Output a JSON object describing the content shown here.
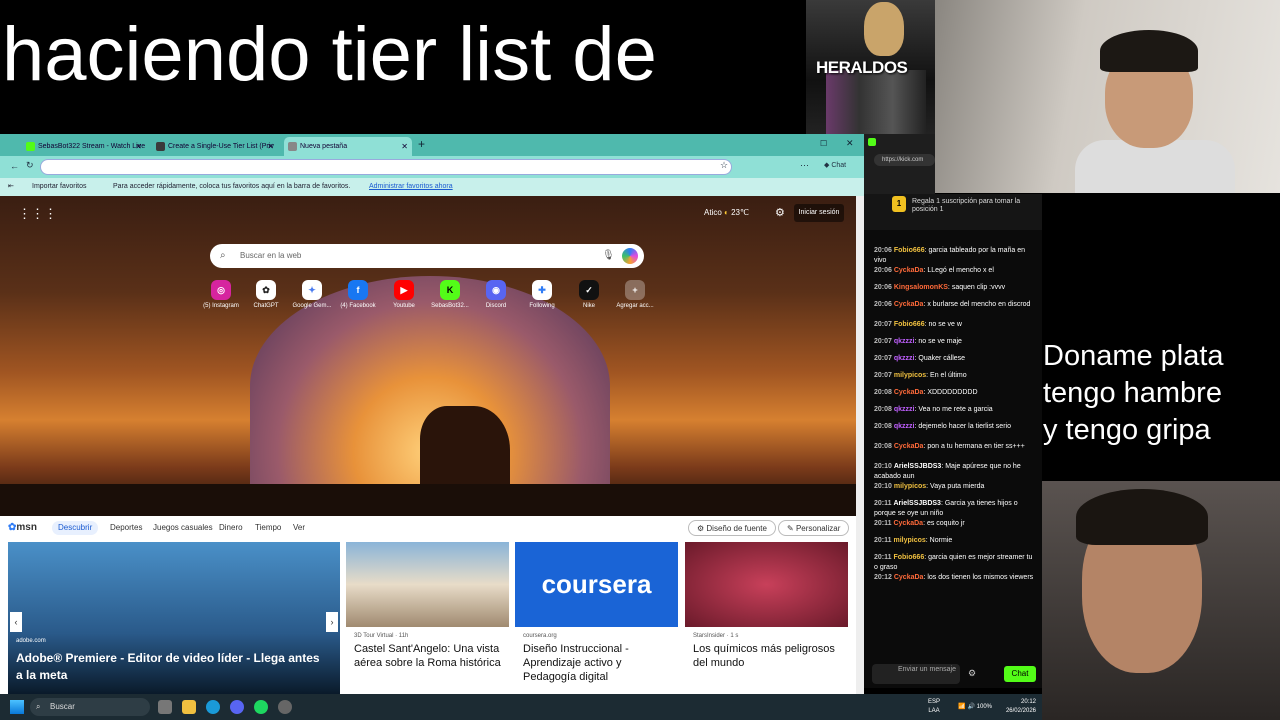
{
  "overlay": {
    "title": "haciendo tier list de",
    "heraldos_label": "HERALDOS",
    "donate_text": [
      "Doname plata",
      "tengo hambre",
      "y tengo gripa"
    ]
  },
  "browser": {
    "tabs": [
      {
        "label": "SebasBot322 Stream - Watch Live",
        "color": "#53fc18"
      },
      {
        "label": "Create a Single-Use Tier List (Priv",
        "color": "#3a3a3a"
      },
      {
        "label": "Nueva pestaña",
        "color": "#888"
      }
    ],
    "chat_button": "Chat",
    "favorites": {
      "import": "Importar favoritos",
      "hint": "Para acceder rápidamente, coloca tus favoritos aquí en la barra de favoritos.",
      "manage": "Administrar favoritos ahora"
    },
    "ntp": {
      "weather_city": "Atico",
      "weather_temp": "23℃",
      "signin": "Iniciar sesión",
      "search_placeholder": "Buscar en la web",
      "shortcuts": [
        "(5) Instagram",
        "ChatGPT",
        "Google Gem...",
        "(4) Facebook",
        "Youtube",
        "SebasBot32...",
        "Discord",
        "Following",
        "Nike",
        "Agregar acc..."
      ]
    },
    "msn": {
      "logo": "msn",
      "tabs": [
        "Descubrir",
        "Deportes",
        "Juegos casuales",
        "Dinero",
        "Tiempo",
        "Ver"
      ],
      "layout_btn": "Diseño de fuente",
      "personalize_btn": "Personalizar",
      "cards": [
        {
          "source": "adobe.com",
          "title": "Adobe® Premiere - Editor de video líder - Llega antes a la meta"
        },
        {
          "source": "3D Tour Virtual · 11h",
          "title": "Castel Sant'Angelo: Una vista aérea sobre la Roma histórica"
        },
        {
          "source": "coursera.org",
          "title": "Diseño Instruccional - Aprendizaje activo y Pedagogía digital",
          "logo": "coursera"
        },
        {
          "source": "StarsInsider · 1 s",
          "title": "Los químicos más peligrosos del mundo"
        }
      ]
    }
  },
  "chat": {
    "url": "https://kick.com",
    "gift_text": "Regala 1 suscripción para tomar la posición 1",
    "messages": [
      {
        "time": "20:06",
        "user": "Fobio666",
        "color": "#f0c040",
        "text": "garcia tableado por la maña en vivo"
      },
      {
        "time": "20:06",
        "user": "CyckaDa",
        "color": "#ff6a3a",
        "text": "LLegó el mencho x el"
      },
      {
        "time": "20:06",
        "user": "KingsalomonKS",
        "color": "#ff6a3a",
        "text": "saquen clip :vvvv"
      },
      {
        "time": "20:06",
        "user": "CyckaDa",
        "color": "#ff6a3a",
        "text": "x burlarse del mencho en discrod"
      },
      {
        "time": "20:07",
        "user": "Fobio666",
        "color": "#f0c040",
        "text": "no se ve w"
      },
      {
        "time": "20:07",
        "user": "qkzzzi",
        "color": "#c060ff",
        "text": "no se ve maje"
      },
      {
        "time": "20:07",
        "user": "qkzzzi",
        "color": "#c060ff",
        "text": "Quaker cállese"
      },
      {
        "time": "20:07",
        "user": "milypicos",
        "color": "#f0c040",
        "text": "En el último"
      },
      {
        "time": "20:08",
        "user": "CyckaDa",
        "color": "#ff6a3a",
        "text": "XDDDDDDDDD"
      },
      {
        "time": "20:08",
        "user": "qkzzzi",
        "color": "#c060ff",
        "text": "Vea no me rete a garcia"
      },
      {
        "time": "20:08",
        "user": "qkzzzi",
        "color": "#c060ff",
        "text": "dejemelo hacer la tierlist serio"
      },
      {
        "time": "20:08",
        "user": "CyckaDa",
        "color": "#ff6a3a",
        "text": "pon a tu hermana en tier ss+++"
      },
      {
        "time": "20:10",
        "user": "ArielSSJBDS3",
        "color": "#ffffff",
        "text": "Maje apúrese que no he acabado aun"
      },
      {
        "time": "20:10",
        "user": "milypicos",
        "color": "#f0c040",
        "text": "Vaya puta mierda"
      },
      {
        "time": "20:11",
        "user": "ArielSSJBDS3",
        "color": "#ffffff",
        "text": "Garcia ya tienes hijos o porque se oye un niño"
      },
      {
        "time": "20:11",
        "user": "CyckaDa",
        "color": "#ff6a3a",
        "text": "es coquito jr"
      },
      {
        "time": "20:11",
        "user": "milypicos",
        "color": "#f0c040",
        "text": "Normie"
      },
      {
        "time": "20:11",
        "user": "Fobio666",
        "color": "#f0c040",
        "text": "garcia quien es mejor streamer tu o graso"
      },
      {
        "time": "20:12",
        "user": "CyckaDa",
        "color": "#ff6a3a",
        "text": "los dos tienen los mismos viewers"
      }
    ],
    "input_placeholder": "Enviar un mensaje",
    "send_button": "Chat"
  },
  "taskbar": {
    "search": "Buscar",
    "lang": "ESP",
    "lang2": "LAA",
    "battery": "100%",
    "time": "20:12",
    "date": "26/02/2026"
  }
}
